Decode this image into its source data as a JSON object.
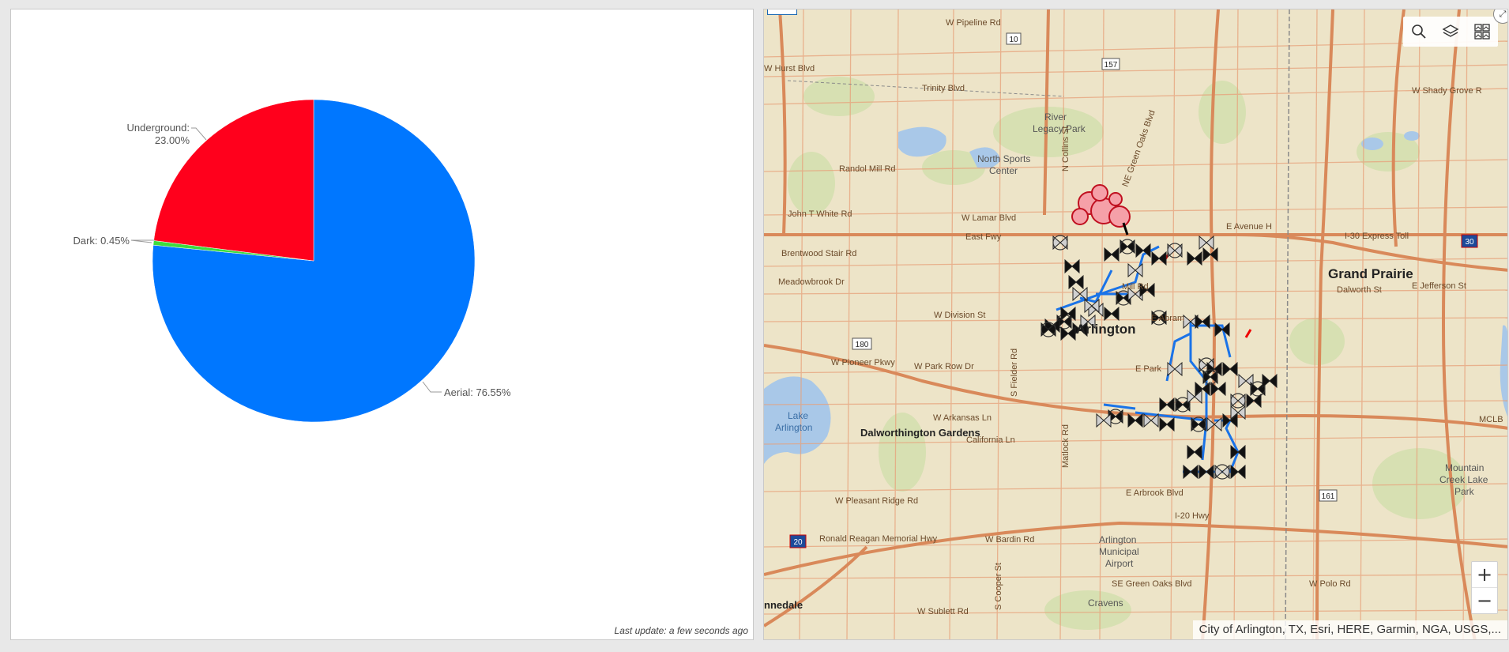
{
  "chart_data": {
    "type": "pie",
    "slices": [
      {
        "label": "Aerial",
        "value": 76.55,
        "display": "Aerial: 76.55%",
        "color": "#0077ff"
      },
      {
        "label": "Dark",
        "value": 0.45,
        "display": "Dark: 0.45%",
        "color": "#3ddb3d"
      },
      {
        "label": "Underground",
        "value": 23.0,
        "display_line1": "Underground:",
        "display_line2": "23.00%",
        "color": "#ff001c"
      }
    ]
  },
  "chart_panel": {
    "last_update": "Last update: a few seconds ago"
  },
  "map": {
    "attribution": "City of Arlington, TX, Esri, HERE, Garmin, NGA, USGS,...",
    "toolbar": {
      "search_icon": "search-icon",
      "layers_icon": "layers-icon",
      "basemap_icon": "basemap-gallery-icon"
    },
    "zoom_in": "+",
    "zoom_out": "−",
    "labels": {
      "arlington": "Arlington",
      "grand_prairie": "Grand Prairie",
      "dalworthington": "Dalworthington Gardens",
      "river_legacy": "River",
      "river_legacy2": "Legacy Park",
      "north_sports": "North Sports",
      "north_sports2": "Center",
      "lake_arlington": "Lake",
      "lake_arlington2": "Arlington",
      "mountain_creek": "Mountain",
      "mountain_creek2": "Creek Lake",
      "mountain_creek3": "Park",
      "airport": "Arlington",
      "airport2": "Municipal",
      "airport3": "Airport",
      "cravens": "Cravens",
      "nnedale": "nnedale",
      "pipeline": "W Pipeline Rd",
      "hurst": "W Hurst Blvd",
      "trinity": "Trinity Blvd",
      "randol": "Randol Mill Rd",
      "john_white": "John T White Rd",
      "lamar": "W Lamar Blvd",
      "brentwood": "Brentwood Stair Rd",
      "meadowbrook": "Meadowbrook Dr",
      "division": "W Division St",
      "pioneer": "W Pioneer Pkwy",
      "park_row": "W Park Row Dr",
      "arkansas": "W Arkansas Ln",
      "california": "California Ln",
      "pleasant_ridge": "W Pleasant Ridge Rd",
      "ronald_reagan": "Ronald Reagan Memorial Hwy",
      "bardin": "W Bardin Rd",
      "sublett": "W Sublett Rd",
      "abram": "E Abram",
      "arbrook": "E Arbrook Blvd",
      "i20": "I-20 Hwy",
      "avenue_h": "E Avenue H",
      "i30": "I-30 Express Toll",
      "dalworth": "Dalworth St",
      "jefferson": "E Jefferson St",
      "shady_grove": "W Shady Grove R",
      "polo": "W Polo Rd",
      "east_fwy": "East Fwy",
      "mclb": "MCLB",
      "collins": "N Collins St",
      "green_oaks": "NE Green Oaks Blvd",
      "s_cooper": "S Cooper St",
      "s_fielder": "S Fielder Rd",
      "matlock": "Matlock Rd",
      "mill_rd": "Mill Rd",
      "e_park": "E Park",
      "se_green_oaks": "SE Green Oaks Blvd",
      "shield_10": "10",
      "shield_157": "157",
      "shield_180": "180",
      "shield_30": "30",
      "shield_161": "161",
      "shield_20": "20"
    }
  }
}
